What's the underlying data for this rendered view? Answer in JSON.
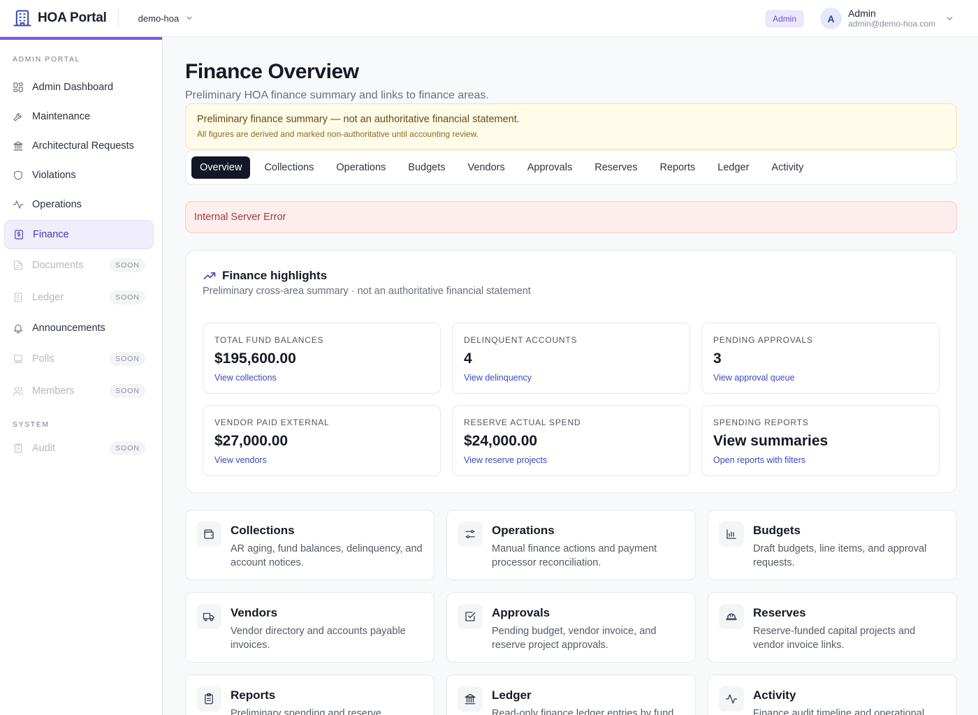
{
  "app": {
    "name": "HOA Portal",
    "tenant": "demo-hoa"
  },
  "user": {
    "role_badge": "Admin",
    "avatar_initial": "A",
    "name": "Admin",
    "email": "admin@demo-hoa.com"
  },
  "sidebar": {
    "section_admin": "ADMIN PORTAL",
    "section_system": "SYSTEM",
    "soon_label": "SOON",
    "items": [
      {
        "label": "Admin Dashboard",
        "icon": "grid-icon"
      },
      {
        "label": "Maintenance",
        "icon": "wrench-icon"
      },
      {
        "label": "Architectural Requests",
        "icon": "landmark-icon"
      },
      {
        "label": "Violations",
        "icon": "shield-icon"
      },
      {
        "label": "Operations",
        "icon": "activity-icon"
      },
      {
        "label": "Finance",
        "icon": "receipt-icon",
        "active": true
      },
      {
        "label": "Documents",
        "icon": "file-icon",
        "soon": true
      },
      {
        "label": "Ledger",
        "icon": "ledger-icon",
        "soon": true
      },
      {
        "label": "Announcements",
        "icon": "bell-icon"
      },
      {
        "label": "Polls",
        "icon": "poll-icon",
        "soon": true
      },
      {
        "label": "Members",
        "icon": "users-icon",
        "soon": true
      }
    ],
    "system_items": [
      {
        "label": "Audit",
        "icon": "audit-icon",
        "soon": true
      }
    ]
  },
  "page": {
    "title": "Finance Overview",
    "subtitle": "Preliminary HOA finance summary and links to finance areas."
  },
  "warning": {
    "title": "Preliminary finance summary — not an authoritative financial statement.",
    "subtitle": "All figures are derived and marked non-authoritative until accounting review."
  },
  "tabs": [
    "Overview",
    "Collections",
    "Operations",
    "Budgets",
    "Vendors",
    "Approvals",
    "Reserves",
    "Reports",
    "Ledger",
    "Activity"
  ],
  "active_tab": "Overview",
  "error": "Internal Server Error",
  "highlights": {
    "title": "Finance highlights",
    "subtitle": "Preliminary cross-area summary · not an authoritative financial statement",
    "stats": [
      {
        "label": "TOTAL FUND BALANCES",
        "value": "$195,600.00",
        "link": "View collections"
      },
      {
        "label": "DELINQUENT ACCOUNTS",
        "value": "4",
        "link": "View delinquency"
      },
      {
        "label": "PENDING APPROVALS",
        "value": "3",
        "link": "View approval queue"
      },
      {
        "label": "VENDOR PAID EXTERNAL",
        "value": "$27,000.00",
        "link": "View vendors"
      },
      {
        "label": "RESERVE ACTUAL SPEND",
        "value": "$24,000.00",
        "link": "View reserve projects"
      },
      {
        "label": "SPENDING REPORTS",
        "value": "View summaries",
        "link": "Open reports with filters"
      }
    ]
  },
  "cards": [
    {
      "title": "Collections",
      "desc": "AR aging, fund balances, delinquency, and account notices.",
      "icon": "wallet-icon"
    },
    {
      "title": "Operations",
      "desc": "Manual finance actions and payment processor reconciliation.",
      "icon": "sliders-icon"
    },
    {
      "title": "Budgets",
      "desc": "Draft budgets, line items, and approval requests.",
      "icon": "bar-chart-icon"
    },
    {
      "title": "Vendors",
      "desc": "Vendor directory and accounts payable invoices.",
      "icon": "truck-icon"
    },
    {
      "title": "Approvals",
      "desc": "Pending budget, vendor invoice, and reserve project approvals.",
      "icon": "check-square-icon"
    },
    {
      "title": "Reserves",
      "desc": "Reserve-funded capital projects and vendor invoice links.",
      "icon": "hard-hat-icon"
    },
    {
      "title": "Reports",
      "desc": "Preliminary spending and reserve",
      "icon": "clipboard-icon"
    },
    {
      "title": "Ledger",
      "desc": "Read-only finance ledger entries by fund",
      "icon": "bank-icon"
    },
    {
      "title": "Activity",
      "desc": "Finance audit timeline and operational",
      "icon": "pulse-icon"
    }
  ]
}
